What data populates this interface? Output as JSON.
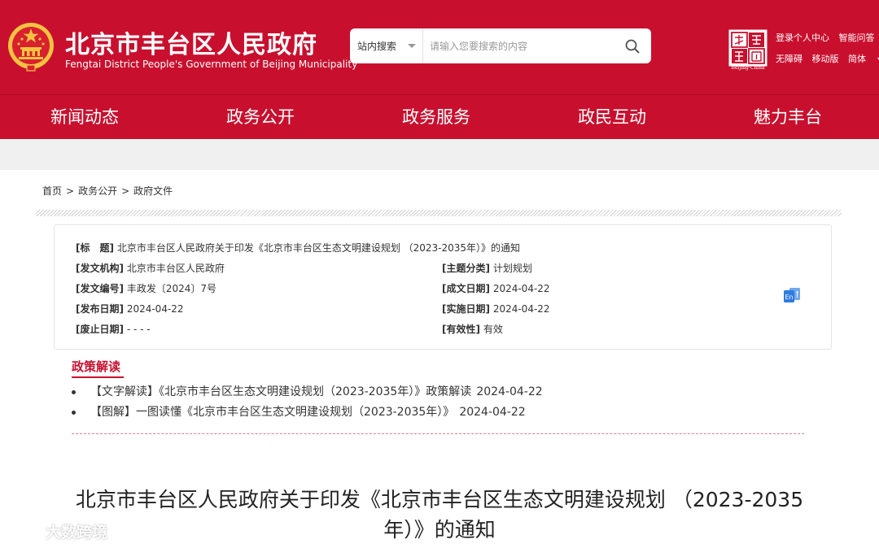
{
  "header": {
    "title": "北京市丰台区人民政府",
    "subtitle": "Fengtai District People's Government of Beijing Municipality",
    "search": {
      "scope": "站内搜索",
      "placeholder": "请输入您要搜索的内容"
    },
    "capital_logo_text": "Beijing·China",
    "links_row1": [
      "登录个人中心",
      "智能问答"
    ],
    "links_row2": [
      "无障碍",
      "移动版",
      "简体"
    ]
  },
  "nav": {
    "items": [
      "新闻动态",
      "政务公开",
      "政务服务",
      "政民互动",
      "魅力丰台"
    ]
  },
  "breadcrumb": [
    "首页",
    "政务公开",
    "政府文件"
  ],
  "breadcrumb_sep": ">",
  "doc_info": {
    "title_label": "[标　题]",
    "title_value": "北京市丰台区人民政府关于印发《北京市丰台区生态文明建设规划 （2023-2035年）》的通知",
    "issuer_label": "[发文机构]",
    "issuer_value": "北京市丰台区人民政府",
    "topic_label": "[主题分类]",
    "topic_value": "计划规划",
    "number_label": "[发文编号]",
    "number_value": "丰政发〔2024〕7号",
    "written_label": "[成文日期]",
    "written_value": "2024-04-22",
    "published_label": "[发布日期]",
    "published_value": "2024-04-22",
    "effective_label": "[实施日期]",
    "effective_value": "2024-04-22",
    "abolished_label": "[废止日期]",
    "abolished_value": "- - - -",
    "validity_label": "[有效性]",
    "validity_value": "有效",
    "english_icon_text": "En"
  },
  "policy": {
    "heading": "政策解读",
    "items": [
      {
        "text": "【文字解读】《北京市丰台区生态文明建设规划（2023-2035年）》政策解读",
        "date": "2024-04-22"
      },
      {
        "text": "【图解】一图读懂《北京市丰台区生态文明建设规划（2023-2035年）》",
        "date": "2024-04-22"
      }
    ]
  },
  "article": {
    "title_line1": "北京市丰台区人民政府关于印发《北京市丰台区生态文明建设规划 （2023-2035",
    "title_line2": "年）》的通知"
  },
  "watermark": "大数跨境",
  "colors": {
    "brand_red": "#c8102e",
    "gold": "#f3c242"
  }
}
